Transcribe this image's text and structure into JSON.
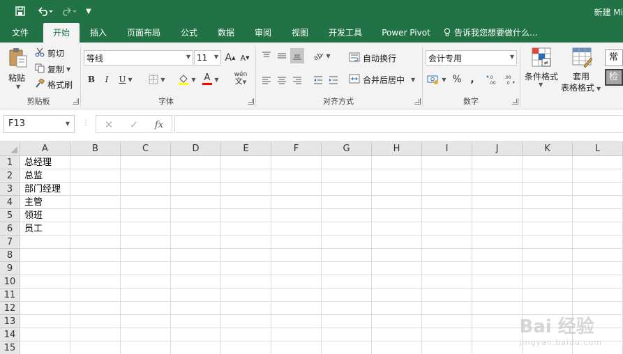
{
  "qat": {
    "save_icon": "save-icon",
    "undo_icon": "undo-icon",
    "redo_icon": "redo-icon"
  },
  "window": {
    "title": "新建 Mi"
  },
  "tabs": [
    {
      "label": "文件"
    },
    {
      "label": "开始"
    },
    {
      "label": "插入"
    },
    {
      "label": "页面布局"
    },
    {
      "label": "公式"
    },
    {
      "label": "数据"
    },
    {
      "label": "审阅"
    },
    {
      "label": "视图"
    },
    {
      "label": "开发工具"
    },
    {
      "label": "Power Pivot"
    }
  ],
  "tell_me": "告诉我您想要做什么...",
  "clipboard": {
    "paste": "粘贴",
    "cut": "剪切",
    "copy": "复制",
    "format_painter": "格式刷",
    "group": "剪贴板"
  },
  "font": {
    "name": "等线",
    "size": "11",
    "grow": "A",
    "shrink": "A",
    "bold": "B",
    "italic": "I",
    "underline": "U",
    "font_color_letter": "A",
    "phonetic": "wén",
    "group": "字体"
  },
  "alignment": {
    "wrap_text": "自动换行",
    "merge_center": "合并后居中",
    "group": "对齐方式"
  },
  "number": {
    "format": "会计专用",
    "percent": "%",
    "comma": ",",
    "group": "数字"
  },
  "styles": {
    "conditional": "条件格式",
    "table_line1": "套用",
    "table_line2": "表格格式",
    "normal": "常规",
    "check": "检查"
  },
  "colors": {
    "accent": "#217346",
    "highlight_yellow": "#ffff00",
    "font_red": "#ff0000"
  },
  "formula_bar": {
    "name_box": "F13",
    "fx": "fx",
    "value": ""
  },
  "columns": [
    "A",
    "B",
    "C",
    "D",
    "E",
    "F",
    "G",
    "H",
    "I",
    "J",
    "K",
    "L"
  ],
  "rows": [
    "1",
    "2",
    "3",
    "4",
    "5",
    "6",
    "7",
    "8",
    "9",
    "10",
    "11",
    "12",
    "13",
    "14",
    "15"
  ],
  "cells": {
    "A1": "总经理",
    "A2": "总监",
    "A3": "部门经理",
    "A4": "主管",
    "A5": "领班",
    "A6": "员工"
  },
  "watermark": {
    "brand": "Bai 经验",
    "url": "jingyan.baidu.com"
  }
}
